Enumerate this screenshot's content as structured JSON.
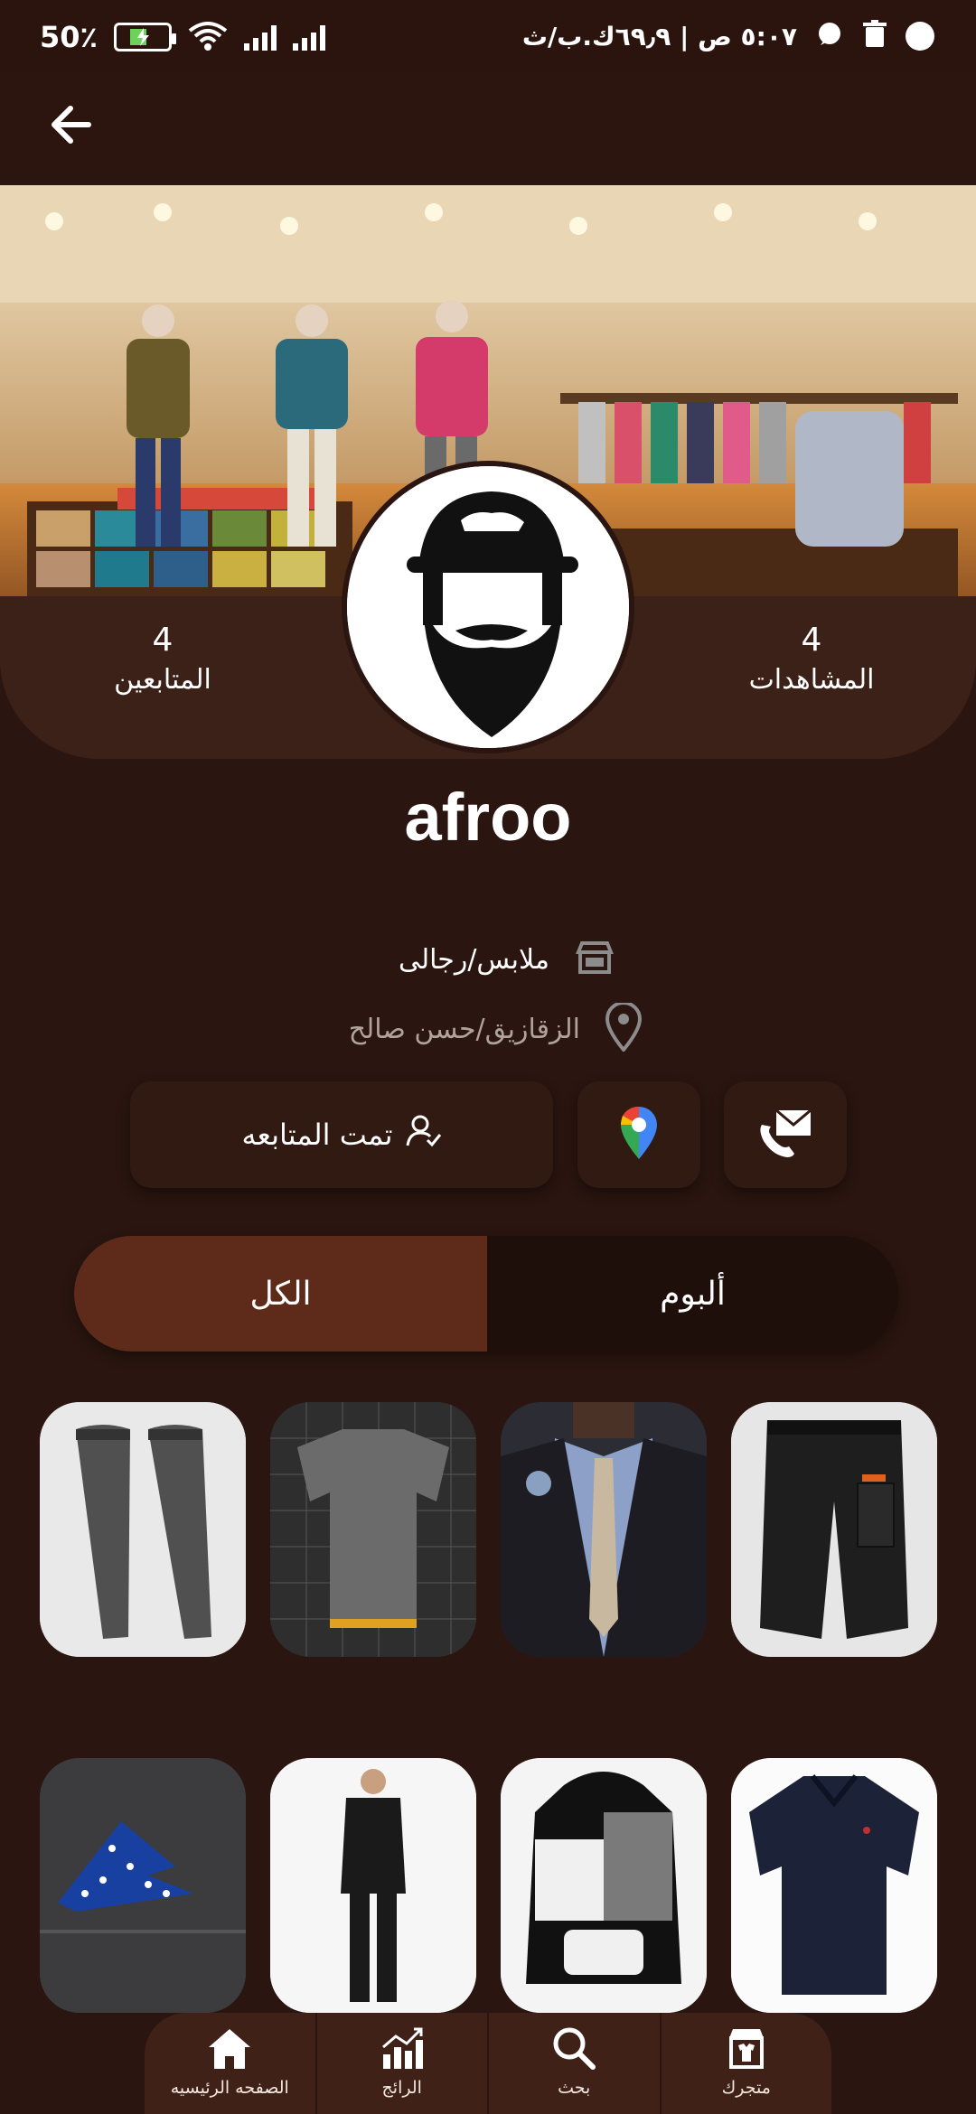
{
  "status_bar": {
    "battery_percent": "50٪",
    "time_and_speed": "٥:٠٧ ص | ٦٩٫٩ك.ب/ث"
  },
  "profile": {
    "name": "afroo",
    "stats": [
      {
        "value": "4",
        "label": "المتابعين"
      },
      {
        "value": "4",
        "label": "المشاهدات"
      }
    ],
    "category": "ملابس/رجالى",
    "location": "الزقازيق/حسن صالح"
  },
  "actions": {
    "follow_label": "تمت المتابعه"
  },
  "tabs": [
    {
      "label": "الكل",
      "selected": true
    },
    {
      "label": "ألبوم",
      "selected": false
    }
  ],
  "products": [
    "grey-track-pants",
    "grey-tshirt",
    "suit-and-tie",
    "black-cargo-pants",
    "blue-pocket-square",
    "black-pajama-set",
    "black-white-hoodie",
    "navy-polo-shirt"
  ],
  "bottom_nav": [
    {
      "label": "الصفحه الرئيسيه",
      "icon": "home-icon"
    },
    {
      "label": "الرائج",
      "icon": "trending-icon"
    },
    {
      "label": "بحث",
      "icon": "search-icon"
    },
    {
      "label": "متجرك",
      "icon": "store-icon"
    }
  ],
  "colors": {
    "background": "#2a1510",
    "panel": "#3b2118",
    "active_tab": "#5e2b1a"
  }
}
